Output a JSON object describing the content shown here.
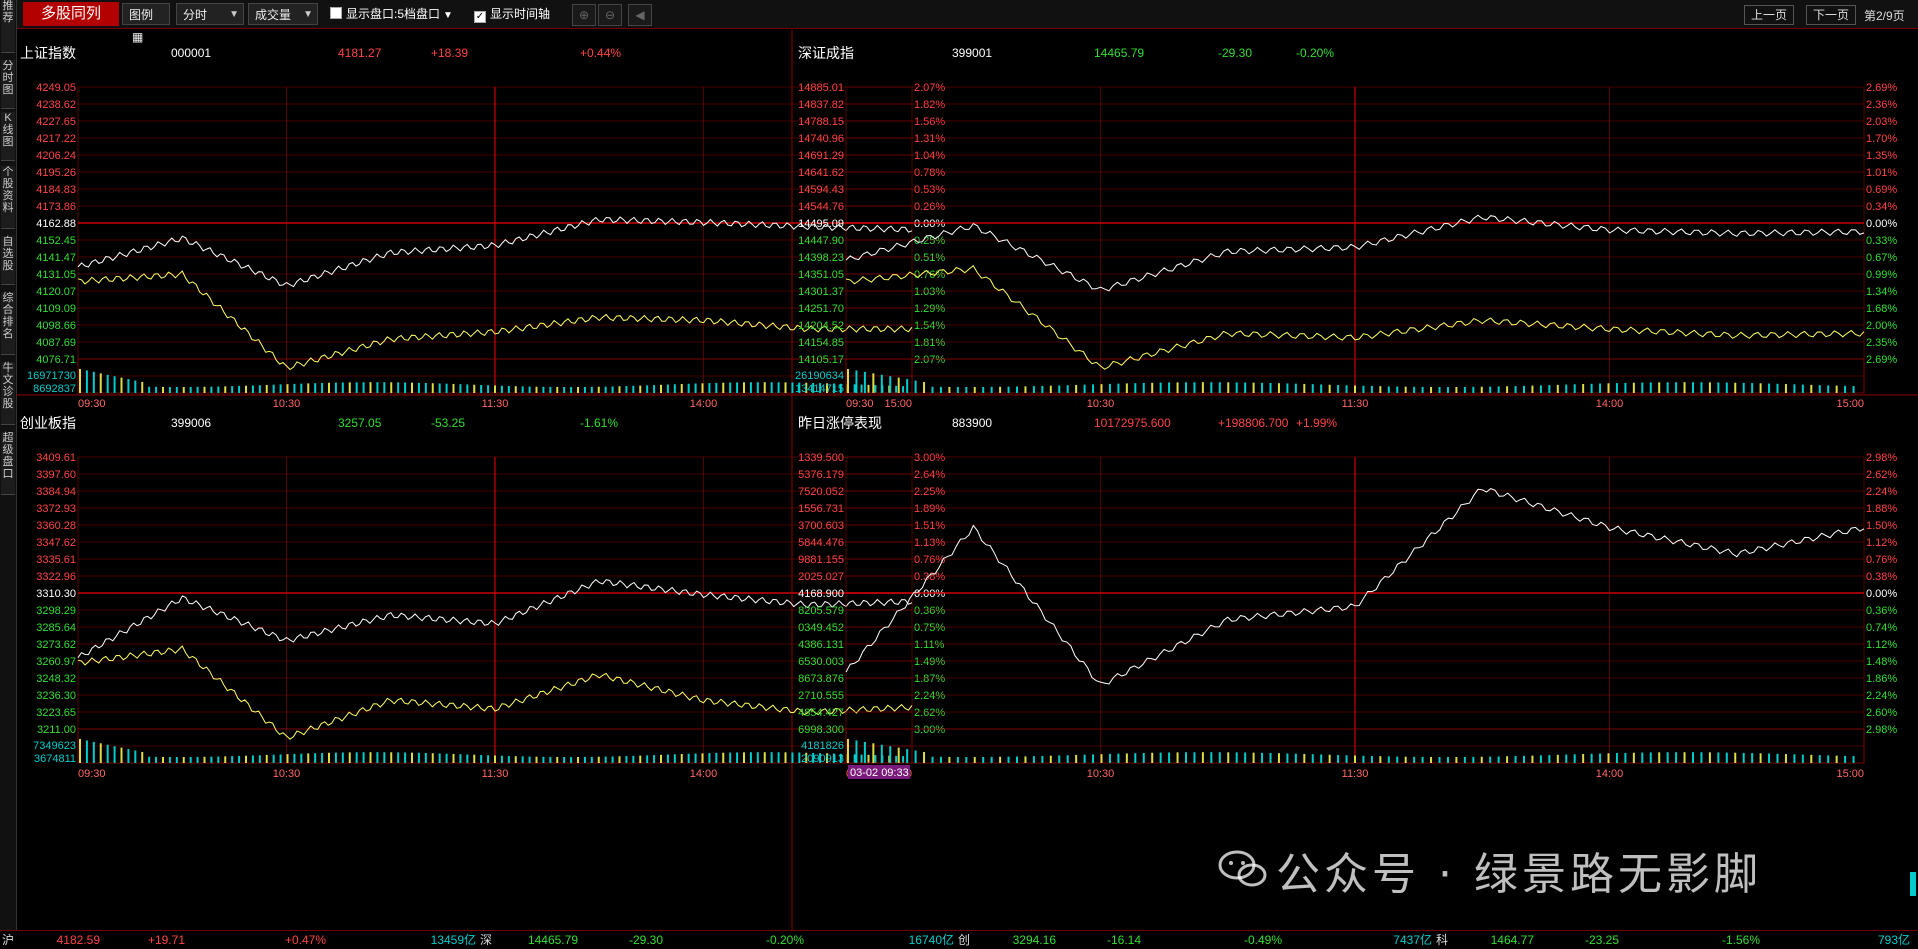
{
  "toolbar": {
    "title": "多股同列",
    "legend_label": "图例",
    "period_label": "分时",
    "indicator_label": "成交量",
    "show_quote_label": "显示盘口:5档盘口",
    "show_time_axis_label": "显示时间轴",
    "prev_page_label": "上一页",
    "next_page_label": "下一页",
    "page_indicator": "第2/9页"
  },
  "sidenav": [
    {
      "label": "推荐"
    },
    {
      "label": "分时图"
    },
    {
      "label": "K线图"
    },
    {
      "label": "个股资料"
    },
    {
      "label": "自选股"
    },
    {
      "label": "综合排名"
    },
    {
      "label": "牛文诊股"
    },
    {
      "label": "超级盘口"
    }
  ],
  "colors": {
    "up": "#ff4444",
    "down": "#33dd33",
    "grid": "#8b0000",
    "price_line": "#ffffff",
    "avg_line": "#ffff66",
    "vol_bar": "#0cc",
    "vol_bar2": "#dddd44"
  },
  "time_labels": [
    "09:30",
    "10:30",
    "11:30",
    "14:00",
    "15:00"
  ],
  "panels": [
    {
      "name": "上证指数",
      "code": "000001",
      "price": "4181.27",
      "change": "+18.39",
      "pct": "+0.44%",
      "dir": "up",
      "left_labels": [
        "4249.05",
        "4238.62",
        "4227.65",
        "4217.22",
        "4206.24",
        "4195.26",
        "4184.83",
        "4173.86",
        "4162.88",
        "4152.45",
        "4141.47",
        "4131.05",
        "4120.07",
        "4109.09",
        "4098.66",
        "4087.69",
        "4076.71"
      ],
      "right_labels": [
        "2.07%",
        "1.82%",
        "1.56%",
        "1.31%",
        "1.04%",
        "0.78%",
        "0.53%",
        "0.26%",
        "0.00%",
        "0.25%",
        "0.51%",
        "0.76%",
        "1.03%",
        "1.29%",
        "1.54%",
        "1.81%",
        "2.07%"
      ],
      "vol_labels": [
        "16971730",
        "8692837"
      ],
      "chart_data": {
        "type": "line",
        "title": "上证指数",
        "x": [
          "09:30",
          "10:00",
          "10:30",
          "11:00",
          "11:30",
          "13:30",
          "14:00",
          "14:30",
          "15:00"
        ],
        "series": [
          {
            "values": [
              4155,
              4175,
              4142,
              4165,
              4170,
              4188,
              4186,
              4183,
              4181
            ]
          },
          {
            "values": [
              4145,
              4150,
              4085,
              4105,
              4110,
              4120,
              4118,
              4112,
              4112
            ]
          }
        ]
      }
    },
    {
      "name": "深证成指",
      "code": "399001",
      "price": "14465.79",
      "change": "-29.30",
      "pct": "-0.20%",
      "dir": "down",
      "left_labels": [
        "14885.01",
        "14837.82",
        "14788.15",
        "14740.96",
        "14691.29",
        "14641.62",
        "14594.43",
        "14544.76",
        "14495.09",
        "14447.90",
        "14398.23",
        "14351.05",
        "14301.37",
        "14251.70",
        "14204.52",
        "14154.85",
        "14105.17"
      ],
      "right_labels": [
        "2.69%",
        "2.36%",
        "2.03%",
        "1.70%",
        "1.35%",
        "1.01%",
        "0.69%",
        "0.34%",
        "0.00%",
        "0.33%",
        "0.67%",
        "0.99%",
        "1.34%",
        "1.68%",
        "2.00%",
        "2.35%",
        "2.69%"
      ],
      "vol_labels": [
        "26190634",
        "13414715"
      ],
      "chart_data": {
        "type": "line",
        "title": "深证成指",
        "x": [
          "09:30",
          "10:00",
          "10:30",
          "11:00",
          "11:30",
          "13:30",
          "14:00",
          "14:30",
          "15:00"
        ],
        "series": [
          {
            "values": [
              14400,
              14480,
              14330,
              14420,
              14430,
              14500,
              14470,
              14462,
              14466
            ]
          },
          {
            "values": [
              14350,
              14380,
              14150,
              14230,
              14220,
              14260,
              14240,
              14225,
              14230
            ]
          }
        ]
      }
    },
    {
      "name": "创业板指",
      "code": "399006",
      "price": "3257.05",
      "change": "-53.25",
      "pct": "-1.61%",
      "dir": "down",
      "left_labels": [
        "3409.61",
        "3397.60",
        "3384.94",
        "3372.93",
        "3360.28",
        "3347.62",
        "3335.61",
        "3322.96",
        "3310.30",
        "3298.29",
        "3285.64",
        "3273.62",
        "3260.97",
        "3248.32",
        "3236.30",
        "3223.65",
        "3211.00"
      ],
      "right_labels": [
        "3.00%",
        "2.64%",
        "2.25%",
        "1.89%",
        "1.51%",
        "1.13%",
        "0.76%",
        "0.38%",
        "0.00%",
        "0.36%",
        "0.75%",
        "1.11%",
        "1.49%",
        "1.87%",
        "2.24%",
        "2.62%",
        "3.00%"
      ],
      "vol_labels": [
        "7349623",
        "3674811"
      ],
      "chart_data": {
        "type": "line",
        "title": "创业板指",
        "x": [
          "09:30",
          "10:00",
          "10:30",
          "11:00",
          "11:30",
          "13:30",
          "14:00",
          "14:30",
          "15:00"
        ],
        "series": [
          {
            "values": [
              3265,
              3300,
              3275,
              3290,
              3285,
              3310,
              3302,
              3296,
              3298
            ]
          },
          {
            "values": [
              3262,
              3270,
              3218,
              3240,
              3235,
              3255,
              3240,
              3233,
              3236
            ]
          }
        ]
      }
    },
    {
      "name": "昨日涨停表现",
      "code": "883900",
      "price": "10172975.600",
      "change": "+198806.700",
      "pct": "+1.99%",
      "dir": "up",
      "left_labels": [
        "1339.500",
        "5376.179",
        "7520.052",
        "1556.731",
        "3700.603",
        "5844.476",
        "9881.155",
        "2025.027",
        "4168.900",
        "8205.579",
        "0349.452",
        "4386.131",
        "6530.003",
        "8673.876",
        "2710.555",
        "4854.427",
        "6998.300"
      ],
      "right_labels": [
        "2.98%",
        "2.62%",
        "2.24%",
        "1.88%",
        "1.50%",
        "1.12%",
        "0.76%",
        "0.38%",
        "0.00%",
        "0.36%",
        "0.74%",
        "1.12%",
        "1.48%",
        "1.86%",
        "2.24%",
        "2.60%",
        "2.98%"
      ],
      "vol_labels": [
        "4181826",
        "2090913"
      ],
      "cursor_label": "03-02 09:33",
      "chart_data": {
        "type": "line",
        "title": "昨日涨停表现",
        "x": [
          "09:30",
          "10:00",
          "10:30",
          "11:00",
          "11:30",
          "13:30",
          "14:00",
          "14:30",
          "15:00"
        ],
        "series": [
          {
            "values": [
              1.2,
              2.3,
              1.1,
              1.6,
              1.7,
              2.6,
              2.3,
              2.1,
              2.3
            ]
          }
        ]
      }
    }
  ],
  "statusbar": [
    {
      "market": "沪",
      "price": "4182.59",
      "change": "+19.71",
      "pct": "+0.47%",
      "amount": "13459亿",
      "dir": "up"
    },
    {
      "market": "深",
      "price": "14465.79",
      "change": "-29.30",
      "pct": "-0.20%",
      "amount": "16740亿",
      "dir": "down"
    },
    {
      "market": "创",
      "price": "3294.16",
      "change": "-16.14",
      "pct": "-0.49%",
      "amount": "7437亿",
      "dir": "down"
    },
    {
      "market": "科",
      "price": "1464.77",
      "change": "-23.25",
      "pct": "-1.56%",
      "amount": "793亿",
      "dir": "down"
    }
  ],
  "watermark": "公众号 · 绿景路无影脚"
}
